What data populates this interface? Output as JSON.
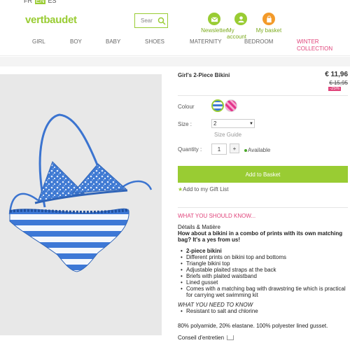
{
  "header": {
    "languages": [
      {
        "label": "FR",
        "active": false
      },
      {
        "label": "EN",
        "active": true
      },
      {
        "label": "ES",
        "active": false
      }
    ],
    "logo": "vertbaudet",
    "search": {
      "value": "Sear",
      "placeholder": "Search",
      "icon": "search-icon"
    },
    "links": [
      {
        "label": "Newsletter",
        "icon": "envelope-icon"
      },
      {
        "label": "My account",
        "icon": "user-icon"
      },
      {
        "label": "My basket",
        "icon": "basket-icon"
      }
    ]
  },
  "nav": [
    {
      "label": "GIRL"
    },
    {
      "label": "BOY"
    },
    {
      "label": "BABY"
    },
    {
      "label": "SHOES"
    },
    {
      "label": "MATERNITY"
    },
    {
      "label": "BEDROOM"
    },
    {
      "label": "WINTER COLLECTION"
    }
  ],
  "product": {
    "title": "Girl's 2-Piece Bikini",
    "price": "€ 11,96",
    "old_price": "€ 15,95",
    "discount": "-25%",
    "colour_label": "Colour",
    "colours": [
      "blue stripe",
      "pink check"
    ],
    "size_label": "Size :",
    "size_value": "2",
    "size_guide": "Size Guide",
    "quantity_label": "Quantity :",
    "quantity_value": "1",
    "quantity_plus": "+",
    "availability": "Available",
    "add_to_basket": "Add to Basket",
    "gift_list": "Add to my Gift List"
  },
  "description": {
    "section_title": "WHAT YOU SHOULD KNOW...",
    "details_heading": "Détails & Matière",
    "intro": "How about a bikini in a combo of prints with its own matching bag? It's a yes from us!",
    "features": [
      "2-piece bikini",
      "Different prints on bikini top and bottoms",
      "Triangle bikini top",
      "Adjustable plaited straps at the back",
      "Briefs with plaited waistband",
      "Lined gusset",
      "Comes with a matching bag with drawstring tie which is practical for carrying wet swimming kit"
    ],
    "need_to_know_title": "WHAT YOU NEED TO KNOW",
    "need_to_know": [
      "Resistant to salt and chlorine"
    ],
    "composition": "80% polyamide, 20% elastane. 100% polyester lined gusset.",
    "care_label": "Conseil d'entretien"
  },
  "colors": {
    "brand_green": "#99cc33",
    "accent_pink": "#e0437a",
    "orange": "#f39a2a"
  }
}
